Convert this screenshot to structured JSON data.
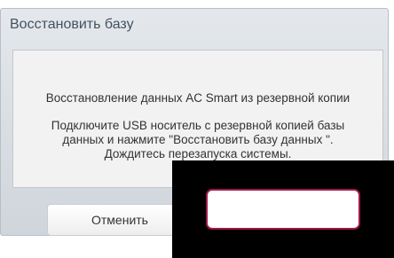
{
  "dialog": {
    "title": "Восстановить базу",
    "restore_heading": "Восстановление данных AC Smart из резервной копии",
    "instructions": [
      "Подключите USB носитель с резервной копией базы",
      "данных и нажмите \"Восстановить базу данных \".",
      "Дождитесь перезапуска системы."
    ],
    "cancel_label": "Отменить",
    "confirm_label": ""
  },
  "colors": {
    "confirm_border": "#a0174c",
    "overlay": "#000000"
  }
}
